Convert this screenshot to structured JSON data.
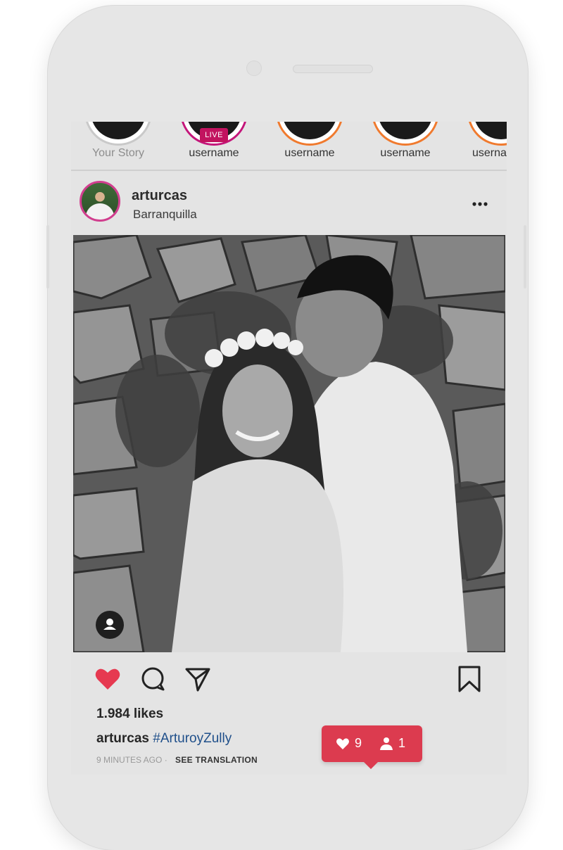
{
  "stories": [
    {
      "label": "Your Story",
      "own": true,
      "live": false
    },
    {
      "label": "username",
      "own": false,
      "live": true
    },
    {
      "label": "username",
      "own": false,
      "live": false
    },
    {
      "label": "username",
      "own": false,
      "live": false
    },
    {
      "label": "userna",
      "own": false,
      "live": false
    }
  ],
  "live_badge": "LIVE",
  "post": {
    "username": "arturcas",
    "location": "Barranquilla",
    "likes": "1.984 likes",
    "caption_user": "arturcas",
    "caption_hashtag": "#ArturoyZully",
    "time": "9 MINUTES AGO",
    "separator": "·",
    "see_translation": "SEE TRANSLATION"
  },
  "notification": {
    "likes_count": "9",
    "followers_count": "1"
  },
  "colors": {
    "like_red": "#e63950",
    "notification_bg": "#dc3b4f",
    "live_pink": "#c2135f",
    "story_ring": "#f07a2e",
    "hashtag_blue": "#1f4f8a"
  },
  "icons": {
    "like": "heart-icon",
    "comment": "comment-icon",
    "share": "send-icon",
    "save": "bookmark-icon",
    "more": "more-icon",
    "tag": "user-tag-icon"
  }
}
